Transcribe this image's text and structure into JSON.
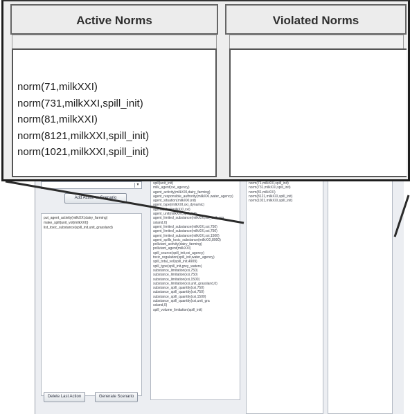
{
  "panels": {
    "active": {
      "title": "Active Norms",
      "items": [
        "norm(71,milkXXI)",
        "norm(731,milkXXI,spill_init)",
        "norm(81,milkXXI)",
        "norm(8121,milkXXI,spill_init)",
        "norm(1021,milkXXI,spill_init)"
      ]
    },
    "violated": {
      "title": "Violated Norms",
      "items": []
    }
  },
  "background_app": {
    "combo_value": "",
    "add_action_button": "Add Action to Scenario",
    "action_list": [
      "put_agent_activity(milkXXI,dairy_farming)",
      "make_spill(unit_vol(milkXXI))",
      "list_toxic_substance(spill_init,unit_grassland)"
    ],
    "delete_button": "Delete Last Action",
    "generate_button": "Generate Scenario",
    "facts_list": [
      "spill(unit_init)",
      "milk_agent(xxi_agency)",
      "agent_activity(milkXXI,dairy_farming)",
      "agent_responsible_authority(milkXXI,water_agency)",
      "agent_situation(milkXXI,init)",
      "agent_type(milkXXI,xxi_dynamic)",
      "agent_label(milkXXI,xxi)",
      "agent_unit(milkXXI,spill_init)",
      "agent_limited_substance(milkXXI,xxi_unit_gra",
      "ssland,0)",
      "agent_limited_substance(milkXXI,xxi,750)",
      "agent_limited_substance(milkXXI,xxi,750)",
      "agent_limited_substance(milkXXI,xxi,1500)",
      "agent_spills_toxic_substance(milkXXI,8000)",
      "pollutant_activity(dairy_farming)",
      "pollutant_agent(milkXXI)",
      "spill_source(spill_init,xxi_agency)",
      "toxic_regulation(spill_init,water_agency)",
      "spill_total_vol(spill_init,4909)",
      "spill_type(spill_init,grey_waters)",
      "substance_limitation(xxi,750)",
      "substance_limitation(xxi,750)",
      "substance_limitation(xxi,1500)",
      "substance_limitation(xxi,unit_grassland,0)",
      "substance_spill_quantity(xxi,750)",
      "substance_spill_quantity(xxi,750)",
      "substance_spill_quantity(xxi,1500)",
      "substance_spill_quantity(xxi,unit_gra",
      "ssland,0)",
      "spill_volume_limitation(spill_init)"
    ],
    "active_small": [
      "norm(71,milkXXI,spill_init)",
      "norm(731,milkXXI,spill_init)",
      "norm(81,milkXXI)",
      "norm(8121,milkXXI,spill_init)",
      "norm(1021,milkXXI,spill_init)"
    ]
  }
}
